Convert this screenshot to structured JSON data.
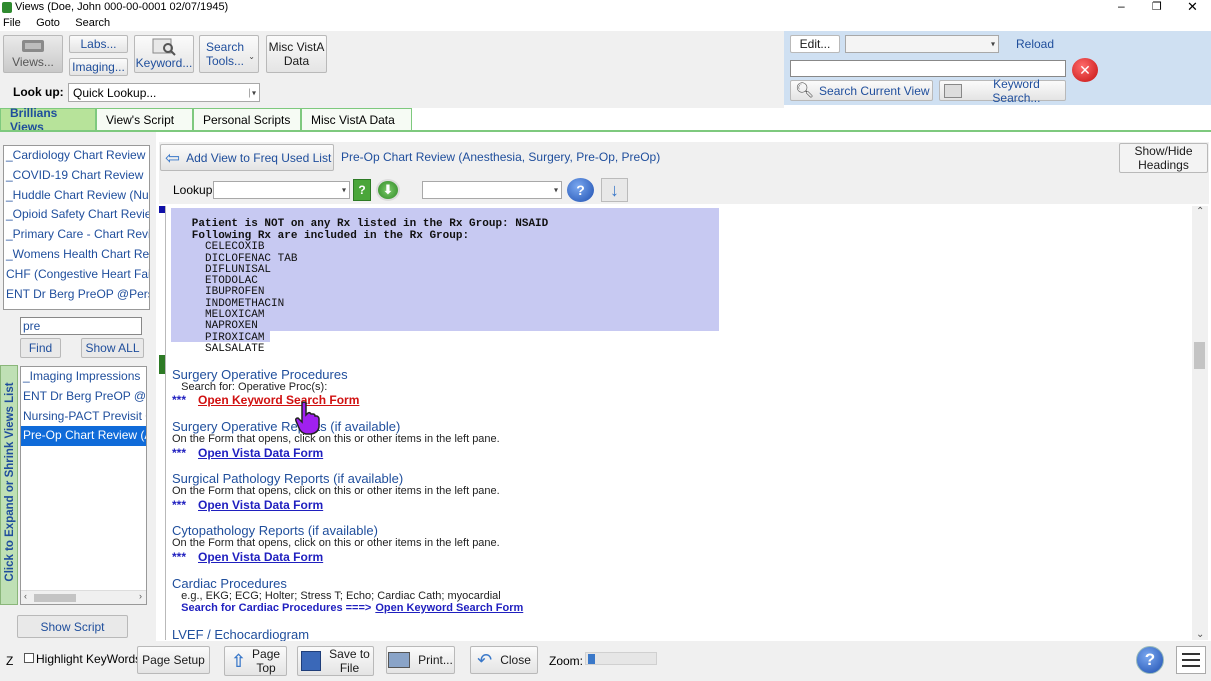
{
  "window": {
    "title": "Views (Doe, John  000-00-0001  02/07/1945)",
    "controls": [
      "–",
      "❐",
      "✕"
    ]
  },
  "menu": [
    "File",
    "Goto",
    "Search"
  ],
  "toolbar": {
    "views": "Views...",
    "labs": "Labs...",
    "imaging": "Imaging...",
    "keyword": "Keyword...",
    "search_tools": "Search\nTools...",
    "misc_vista": "Misc VistA\nData",
    "lookup_label": "Look up:",
    "lookup_value": "Quick Lookup..."
  },
  "right_panel": {
    "edit": "Edit...",
    "reload": "Reload",
    "search_current_view": "Search Current View",
    "keyword_search": "Keyword Search..."
  },
  "tabs": [
    "Brillians Views",
    "View's Script",
    "Personal Scripts",
    "Misc VistA Data"
  ],
  "left": {
    "views_list": [
      "_Cardiology Chart Review",
      "_COVID-19 Chart Review",
      "_Huddle Chart Review (Nursi",
      "_Opioid Safety Chart Review",
      "_Primary Care - Chart Review",
      "_Womens Health Chart Revie",
      "CHF (Congestive Heart Fail C",
      "ENT Dr Berg PreOP @Persor"
    ],
    "filter_value": "pre",
    "find": "Find",
    "show_all": "Show ALL",
    "filtered_list": [
      "_Imaging Impressions",
      "ENT Dr Berg PreOP @Pe",
      "Nursing-PACT Previsit Ch",
      "Pre-Op Chart Review (An"
    ],
    "selected_index": 3,
    "vertical_label": "Click to Expand or Shrink Views List",
    "show_script": "Show Script"
  },
  "content_header": {
    "add_view": "Add View to Freq Used List",
    "view_title": "Pre-Op Chart Review (Anesthesia, Surgery, Pre-Op, PreOp)",
    "show_hide": "Show/Hide\nHeadings",
    "lookup_label": "Lookup:"
  },
  "rx_block": {
    "lines": [
      "   Patient is NOT on any Rx listed in the Rx Group: NSAID",
      "   Following Rx are included in the Rx Group:",
      "     CELECOXIB",
      "     DICLOFENAC TAB",
      "     DIFLUNISAL",
      "     ETODOLAC",
      "     IBUPROFEN",
      "     INDOMETHACIN",
      "     MELOXICAM",
      "     NAPROXEN",
      "     PIROXICAM",
      "     SALSALATE"
    ]
  },
  "sections": [
    {
      "title": "Surgery Operative Procedures",
      "sub": "   Search for: Operative Proc(s):",
      "prefix": "***",
      "link": "Open Keyword Search Form",
      "link_color": "#d01010"
    },
    {
      "title": "Surgery Operative Reports (if available)",
      "sub": "On the Form that opens, click on this or other items in the left pane.",
      "prefix": "***",
      "link": "Open Vista Data Form",
      "link_color": "#1f1fbf"
    },
    {
      "title": "Surgical Pathology Reports (if available)",
      "sub": "On the Form that opens, click on this or other items in the left pane.",
      "prefix": "***",
      "link": "Open Vista Data Form",
      "link_color": "#1f1fbf"
    },
    {
      "title": "Cytopathology Reports (if available)",
      "sub": "On the Form that opens, click on this or other items in the left pane.",
      "prefix": "***",
      "link": "Open Vista Data Form",
      "link_color": "#1f1fbf"
    },
    {
      "title": "Cardiac Procedures",
      "sub": "   e.g., EKG; ECG; Holter; Stress T; Echo; Cardiac Cath; myocardial",
      "prefix": "   Search for Cardiac Procedures ===>",
      "link": "Open Keyword Search Form",
      "link_color": "#1f1fbf"
    }
  ],
  "last_section": "LVEF / Echocardiogram",
  "bottom": {
    "z": "Z",
    "highlight": "Highlight KeyWords",
    "page_setup": "Page Setup",
    "page_top": "Page\nTop",
    "save_to_file": "Save to\nFile",
    "print": "Print...",
    "close": "Close",
    "zoom": "Zoom:"
  },
  "colors": {
    "accent": "#1f4e9c",
    "tab_active": "#b7e39a",
    "selection": "#0f6bd9",
    "rx_highlight": "#c7c9f2",
    "right_panel_bg": "#cfe0f2"
  }
}
